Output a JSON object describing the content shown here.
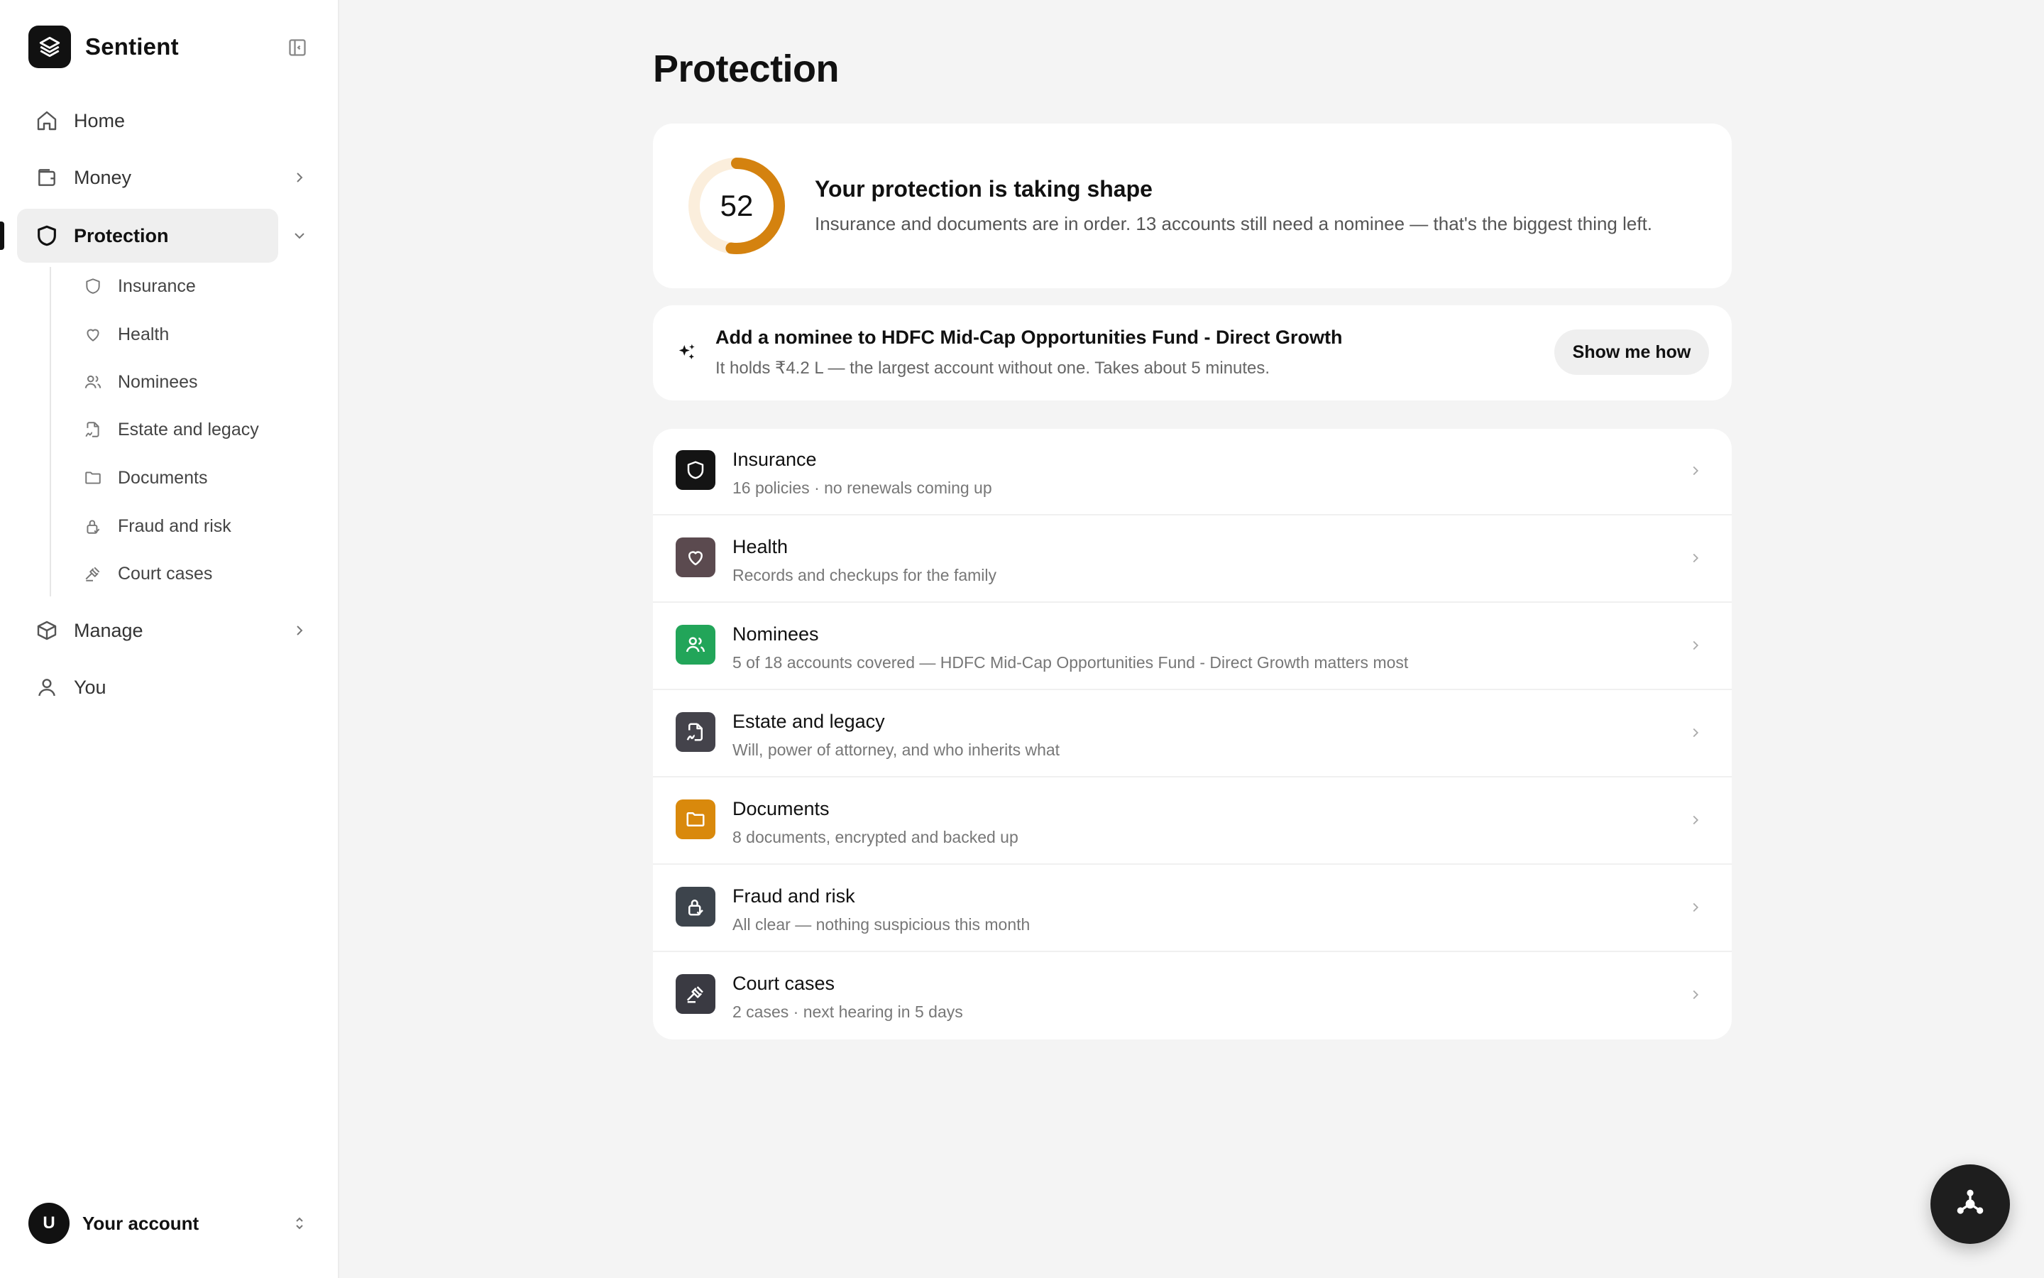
{
  "brand": {
    "name": "Sentient"
  },
  "nav": {
    "home": "Home",
    "money": "Money",
    "protection": "Protection",
    "manage": "Manage",
    "you": "You"
  },
  "subnav": [
    {
      "label": "Insurance",
      "icon": "shield-icon"
    },
    {
      "label": "Health",
      "icon": "heart-icon"
    },
    {
      "label": "Nominees",
      "icon": "users-icon"
    },
    {
      "label": "Estate and legacy",
      "icon": "file-signature-icon"
    },
    {
      "label": "Documents",
      "icon": "folder-icon"
    },
    {
      "label": "Fraud and risk",
      "icon": "lock-check-icon"
    },
    {
      "label": "Court cases",
      "icon": "gavel-icon"
    }
  ],
  "account": {
    "avatar_initial": "U",
    "label": "Your account"
  },
  "page": {
    "title": "Protection"
  },
  "score": {
    "value": "52",
    "progress": 0.52,
    "title": "Your protection is taking shape",
    "description": "Insurance and documents are in order. 13 accounts still need a nominee — that's the biggest thing left."
  },
  "nudge": {
    "title": "Add a nominee to HDFC Mid-Cap Opportunities Fund - Direct Growth",
    "subtitle": "It holds ₹4.2 L — the largest account without one. Takes about 5 minutes.",
    "button": "Show me how"
  },
  "rows": [
    {
      "title": "Insurance",
      "subtitle": "16 policies · no renewals coming up",
      "icon": "shield-icon",
      "color": "#141414"
    },
    {
      "title": "Health",
      "subtitle": "Records and checkups for the family",
      "icon": "heart-icon",
      "color": "#5b4a4f"
    },
    {
      "title": "Nominees",
      "subtitle": "5 of 18 accounts covered — HDFC Mid-Cap Opportunities Fund - Direct Growth matters most",
      "icon": "users-icon",
      "color": "#22a559"
    },
    {
      "title": "Estate and legacy",
      "subtitle": "Will, power of attorney, and who inherits what",
      "icon": "file-signature-icon",
      "color": "#44434b"
    },
    {
      "title": "Documents",
      "subtitle": "8 documents, encrypted and backed up",
      "icon": "folder-icon",
      "color": "#d9890c"
    },
    {
      "title": "Fraud and risk",
      "subtitle": "All clear — nothing suspicious this month",
      "icon": "lock-check-icon",
      "color": "#3d444c"
    },
    {
      "title": "Court cases",
      "subtitle": "2 cases · next hearing in 5 days",
      "icon": "gavel-icon",
      "color": "#3a3a42"
    }
  ],
  "colors": {
    "ring_track": "#fbeedc",
    "ring_fill": "#d4820f",
    "accent_dark": "#111111"
  }
}
